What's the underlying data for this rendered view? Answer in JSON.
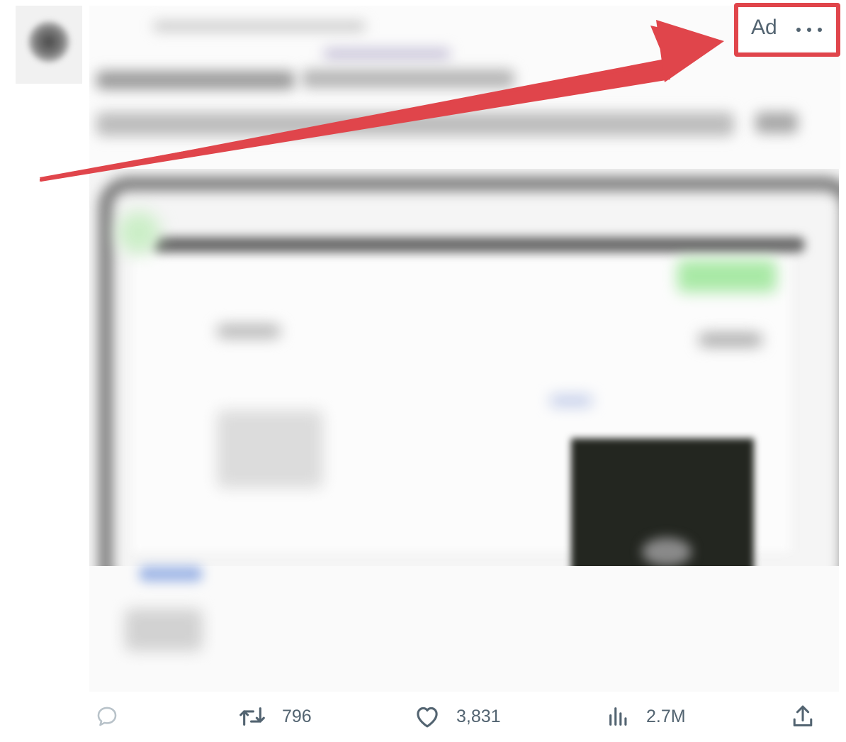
{
  "tweet": {
    "ad_label": "Ad",
    "more_icon": "more-horizontal-icon"
  },
  "actions": {
    "reply": {
      "icon": "reply-icon",
      "count": ""
    },
    "retweet": {
      "icon": "retweet-icon",
      "count": "796"
    },
    "like": {
      "icon": "heart-icon",
      "count": "3,831"
    },
    "views": {
      "icon": "analytics-icon",
      "count": "2.7M"
    },
    "share": {
      "icon": "share-icon",
      "count": ""
    }
  },
  "annotation": {
    "color": "#e0454b"
  },
  "colors": {
    "icon_gray": "#536471",
    "reply_icon_gray": "#b8c2c9"
  }
}
